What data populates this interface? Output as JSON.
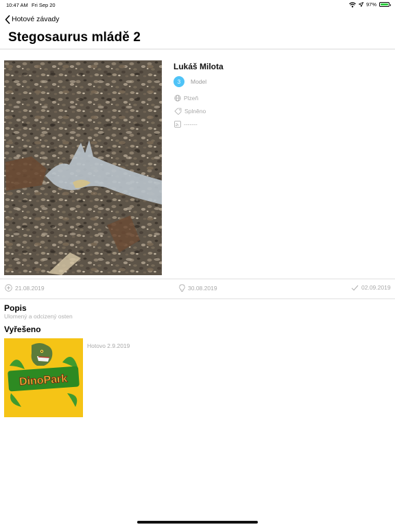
{
  "status_bar": {
    "time": "10:47 AM",
    "date": "Fri Sep 20",
    "battery": "97%",
    "battery_level": 0.97
  },
  "nav": {
    "back_label": "Hotové závady",
    "title": "Stegosaurus mládě 2"
  },
  "detail": {
    "author": "Lukáš Milota",
    "badge_number": "3",
    "badge_label": "Model",
    "location": "Plzeň",
    "status": "Splněno",
    "feed": "-------"
  },
  "dates": {
    "created": "21.08.2019",
    "planned": "30.08.2019",
    "done": "02.09.2019"
  },
  "description": {
    "title": "Popis",
    "text": "Ulomený a odcizený osten"
  },
  "resolved": {
    "title": "Vyřešeno",
    "text": "Hotovo 2.9.2019",
    "logo_text": "DinoPark"
  },
  "colors": {
    "badge": "#4fc3f7",
    "logo_bg": "#f5c416",
    "battery": "#2ecc40",
    "muted_text": "#a8a8a8"
  },
  "icons": [
    "chevron-left-icon",
    "wifi-icon",
    "location-arrow-icon",
    "battery-icon",
    "globe-icon",
    "tag-icon",
    "rss-icon",
    "plus-circle-icon",
    "lightbulb-icon",
    "checkmark-icon"
  ]
}
